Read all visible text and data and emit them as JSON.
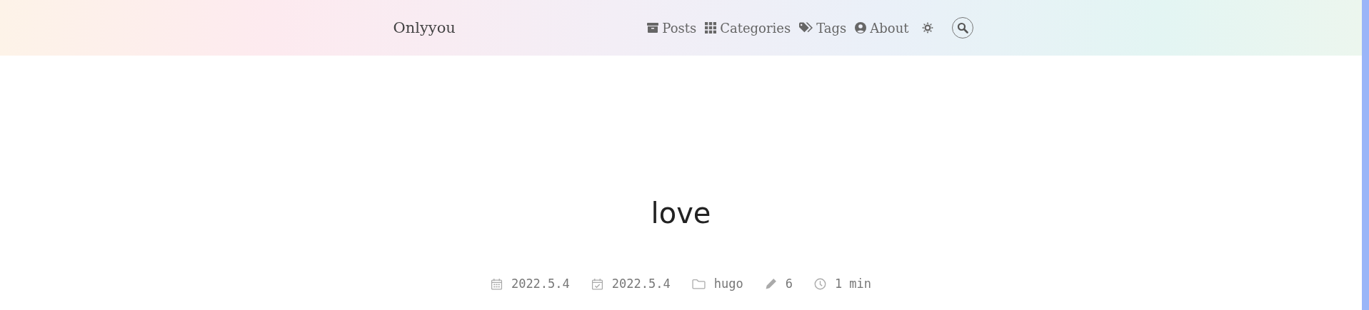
{
  "site": {
    "title": "Onlyyou"
  },
  "nav": [
    {
      "kind": "posts",
      "label": "Posts"
    },
    {
      "kind": "categories",
      "label": "Categories"
    },
    {
      "kind": "tags",
      "label": "Tags"
    },
    {
      "kind": "about",
      "label": "About"
    }
  ],
  "post": {
    "title": "love",
    "meta": [
      {
        "kind": "created",
        "text": "2022.5.4"
      },
      {
        "kind": "updated",
        "text": "2022.5.4"
      },
      {
        "kind": "category",
        "text": "hugo"
      },
      {
        "kind": "words",
        "text": "6"
      },
      {
        "kind": "reading",
        "text": "1 min"
      }
    ]
  }
}
